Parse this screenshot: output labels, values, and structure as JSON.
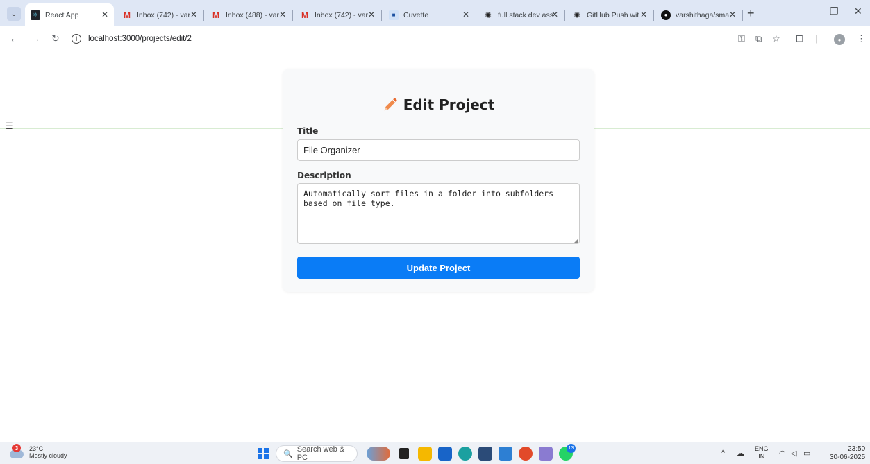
{
  "browser": {
    "tabs": [
      {
        "label": "React App",
        "favicon": "react-icon",
        "active": true
      },
      {
        "label": "Inbox (742) - var",
        "favicon": "gmail-icon"
      },
      {
        "label": "Inbox (488) - var",
        "favicon": "gmail-icon"
      },
      {
        "label": "Inbox (742) - var",
        "favicon": "gmail-icon"
      },
      {
        "label": "Cuvette",
        "favicon": "cuvette-icon"
      },
      {
        "label": "full stack dev ass",
        "favicon": "chatgpt-icon"
      },
      {
        "label": "GitHub Push wit",
        "favicon": "chatgpt-icon"
      },
      {
        "label": "varshithaga/sma",
        "favicon": "github-icon"
      }
    ],
    "new_tab_label": "+",
    "url": "localhost:3000/projects/edit/2"
  },
  "form": {
    "heading": "Edit Project",
    "title_label": "Title",
    "title_value": "File Organizer",
    "description_label": "Description",
    "description_value": "Automatically sort files in a folder into subfolders based on file type.",
    "submit_label": "Update Project",
    "accent_color": "#0a7cf6",
    "icon": "pencil-icon"
  },
  "taskbar": {
    "weather_temp": "23°C",
    "weather_desc": "Mostly cloudy",
    "weather_badge": "3",
    "search_placeholder": "Search web & PC",
    "whatsapp_badge": "13",
    "ime_lang": "ENG",
    "ime_region": "IN",
    "time": "23:50",
    "date": "30-06-2025"
  }
}
